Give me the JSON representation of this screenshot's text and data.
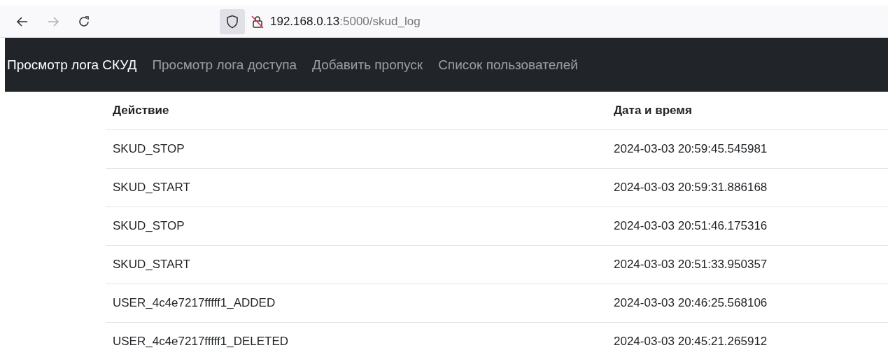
{
  "browser": {
    "back_disabled": false,
    "forward_disabled": true,
    "address": {
      "host": "192.168.0.13",
      "rest": ":5000/skud_log"
    }
  },
  "nav": [
    {
      "label": "Просмотр лога СКУД",
      "selected": true
    },
    {
      "label": "Просмотр лога доступа",
      "selected": false
    },
    {
      "label": "Добавить пропуск",
      "selected": false
    },
    {
      "label": "Список пользователей",
      "selected": false
    }
  ],
  "table": {
    "columns": [
      "Действие",
      "Дата и время"
    ],
    "rows": [
      [
        "SKUD_STOP",
        "2024-03-03 20:59:45.545981"
      ],
      [
        "SKUD_START",
        "2024-03-03 20:59:31.886168"
      ],
      [
        "SKUD_STOP",
        "2024-03-03 20:51:46.175316"
      ],
      [
        "SKUD_START",
        "2024-03-03 20:51:33.950357"
      ],
      [
        "USER_4c4e7217fffff1_ADDED",
        "2024-03-03 20:46:25.568106"
      ],
      [
        "USER_4c4e7217fffff1_DELETED",
        "2024-03-03 20:45:21.265912"
      ]
    ]
  }
}
